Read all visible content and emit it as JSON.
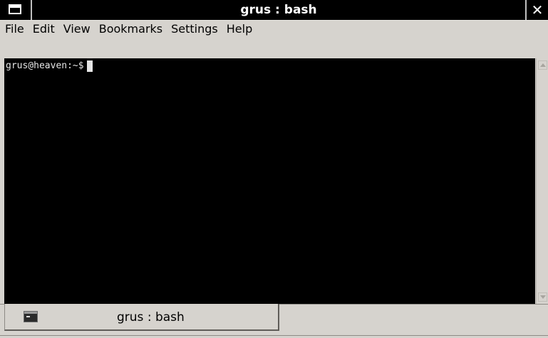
{
  "window": {
    "title": "grus : bash",
    "close_glyph": "✕"
  },
  "menu": {
    "items": [
      {
        "label": "File"
      },
      {
        "label": "Edit"
      },
      {
        "label": "View"
      },
      {
        "label": "Bookmarks"
      },
      {
        "label": "Settings"
      },
      {
        "label": "Help"
      }
    ]
  },
  "terminal": {
    "prompt": "grus@heaven:~$",
    "background": "#000000",
    "foreground": "#e6e6e6"
  },
  "tabs": [
    {
      "label": "grus : bash",
      "icon": "terminal-icon"
    }
  ],
  "icons": {
    "window_menu": "window-menu-icon",
    "close": "close-icon",
    "scroll_up": "scroll-up-icon",
    "scroll_down": "scroll-down-icon"
  }
}
